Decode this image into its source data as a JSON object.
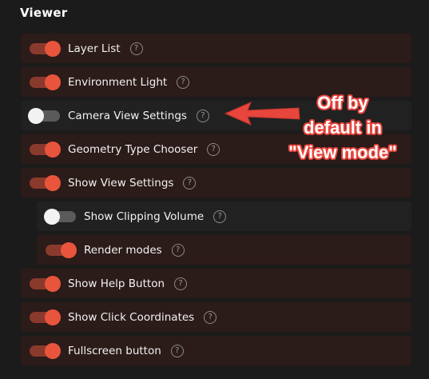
{
  "section": {
    "title": "Viewer"
  },
  "settings": [
    {
      "label": "Layer List",
      "state": "on"
    },
    {
      "label": "Environment Light",
      "state": "on"
    },
    {
      "label": "Camera View Settings",
      "state": "off"
    },
    {
      "label": "Geometry Type Chooser",
      "state": "on"
    },
    {
      "label": "Show View Settings",
      "state": "on"
    },
    {
      "label": "Show Clipping Volume",
      "state": "off"
    },
    {
      "label": "Render modes",
      "state": "on"
    },
    {
      "label": "Show Help Button",
      "state": "on"
    },
    {
      "label": "Show Click Coordinates",
      "state": "on"
    },
    {
      "label": "Fullscreen button",
      "state": "on"
    }
  ],
  "help_glyph": "?",
  "annotation": {
    "lines": [
      "Off by",
      "default in",
      "\"View mode\""
    ],
    "color": "#e8453c"
  },
  "colors": {
    "toggle_on": "#e8553c",
    "toggle_on_track": "#8a3a2c",
    "toggle_off_knob": "#f2f2f2",
    "toggle_off_track": "#5a5a5a",
    "row_background": "#2b1b19",
    "page_background": "#1c1b1b"
  }
}
